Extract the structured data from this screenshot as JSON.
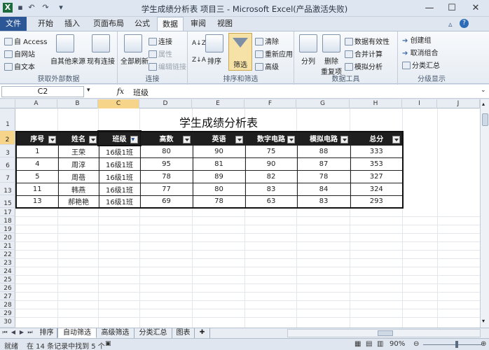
{
  "window": {
    "title": "学生成绩分析表 项目三 - Microsoft Excel(产品激活失败)",
    "qa_icons": [
      "excel-icon",
      "save-icon",
      "undo-icon",
      "redo-icon",
      "customize-icon"
    ]
  },
  "tabs": [
    "文件",
    "开始",
    "插入",
    "页面布局",
    "公式",
    "数据",
    "审阅",
    "视图"
  ],
  "ribbon": {
    "ext_group": {
      "label": "获取外部数据",
      "access": "自 Access",
      "web": "自网站",
      "text": "自文本",
      "other": "自其他来源",
      "existing": "现有连接"
    },
    "conn_group": {
      "label": "连接",
      "refresh": "全部刷新",
      "conn": "连接",
      "props": "属性",
      "edit_links": "编辑链接"
    },
    "sort_group": {
      "label": "排序和筛选",
      "sort": "排序",
      "filter": "筛选",
      "clear": "清除",
      "reapply": "重新应用",
      "advanced": "高级"
    },
    "tools_group": {
      "label": "数据工具",
      "split": "分列",
      "remove": "删除",
      "dup": "重复项",
      "validate": "数据有效性",
      "consolidate": "合并计算",
      "whatif": "模拟分析"
    },
    "outline_group": {
      "label": "分级显示",
      "group": "创建组",
      "ungroup": "取消组合",
      "subtotal": "分类汇总"
    }
  },
  "formula_bar": {
    "name": "C2",
    "fx": "fx",
    "value": "班级"
  },
  "columns": [
    "A",
    "B",
    "C",
    "D",
    "E",
    "F",
    "G",
    "H",
    "I",
    "J"
  ],
  "rows": [
    "1",
    "2",
    "3",
    "6",
    "7",
    "13",
    "15",
    "17",
    "18",
    "19",
    "20",
    "21",
    "22",
    "23",
    "24",
    "25",
    "26",
    "27",
    "28",
    "29",
    "30"
  ],
  "sheet": {
    "title": "学生成绩分析表",
    "headers": [
      "序号",
      "姓名",
      "班级",
      "高数",
      "英语",
      "数字电路",
      "模拟电路",
      "总分"
    ],
    "records": [
      [
        "1",
        "王荣",
        "16级1班",
        "80",
        "90",
        "75",
        "88",
        "333"
      ],
      [
        "4",
        "周淳",
        "16级1班",
        "95",
        "81",
        "90",
        "87",
        "353"
      ],
      [
        "5",
        "周蓓",
        "16级1班",
        "78",
        "89",
        "82",
        "78",
        "327"
      ],
      [
        "11",
        "韩燕",
        "16级1班",
        "77",
        "80",
        "83",
        "84",
        "324"
      ],
      [
        "13",
        "郝艳艳",
        "16级1班",
        "69",
        "78",
        "63",
        "83",
        "293"
      ]
    ]
  },
  "sheet_tabs": [
    "排序",
    "自动筛选",
    "高级筛选",
    "分类汇总",
    "图表"
  ],
  "status": {
    "mode": "就绪",
    "message": "在 14 条记录中找到 5 个",
    "zoom": "90%"
  }
}
